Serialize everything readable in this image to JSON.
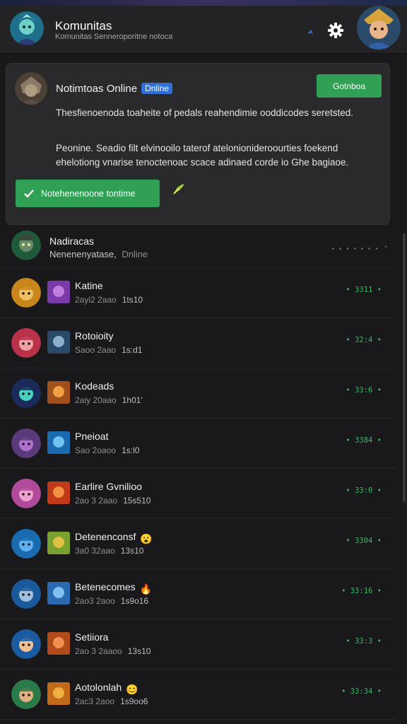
{
  "header": {
    "title": "Komunitas",
    "subtitle": "Komunitas Senneroporitne notoca",
    "app_avatar_icon": "champion-avatar-icon",
    "settings_icon": "gear-icon",
    "profile_icon": "profile-avatar-icon"
  },
  "notice": {
    "title": "Notimtoas Online",
    "badge": "Dnline",
    "top_button": "Gotnboa",
    "paragraph_1": "Thesfienoenoda toaheite of pedals reahendimie ooddicodes seretsted.",
    "paragraph_2": "Peonine. Seadio filt elvinooilo taterof atelonionideroourties foekend ehelotiong vnarise tenoctenoac scace adinaed corde io Ghe bagiaoe.",
    "action_button": "Notehenenoone tontime",
    "accent": "#2fa054"
  },
  "online_row": {
    "name": "Nadiracas",
    "subtitle": "Nenenenyatase,",
    "status": "Dnline",
    "dots": "• • • • • • • ⌃"
  },
  "members": [
    {
      "name": "Katine",
      "date": "2ayi2 2aao",
      "num": "1ts10",
      "value": "• 3311 •",
      "emoji": ""
    },
    {
      "name": "Rotoioity",
      "date": "Saoo 2aao",
      "num": "1s:d1",
      "value": "• 32:4 •",
      "emoji": ""
    },
    {
      "name": "Kodeads",
      "date": "2aiy 20aao",
      "num": "1h01'",
      "value": "• 33:6 •",
      "emoji": ""
    },
    {
      "name": "Pneioat",
      "date": "Sao 2oaoo",
      "num": "1s:l0",
      "value": "• 3384 •",
      "emoji": ""
    },
    {
      "name": "Earlire Gvnilioo",
      "date": "2ao 3 2aao",
      "num": "15s510",
      "value": "• 33:0 •",
      "emoji": ""
    },
    {
      "name": "Detenenconsf",
      "date": "3a0 32aao",
      "num": "13s10",
      "value": "• 3304 •",
      "emoji": "😮"
    },
    {
      "name": "Betenecomes",
      "date": "2ao3 2aoo",
      "num": "1s9o16",
      "value": "• 33:16 •",
      "emoji": "🔥"
    },
    {
      "name": "Setiiora",
      "date": "2ao 3 2aaoo",
      "num": "13s10",
      "value": "• 33:3 •",
      "emoji": ""
    },
    {
      "name": "Aotolonlah",
      "date": "2ac3 2aoo",
      "num": "1s9oo6",
      "value": "• 33:34 •",
      "emoji": "😊"
    }
  ]
}
